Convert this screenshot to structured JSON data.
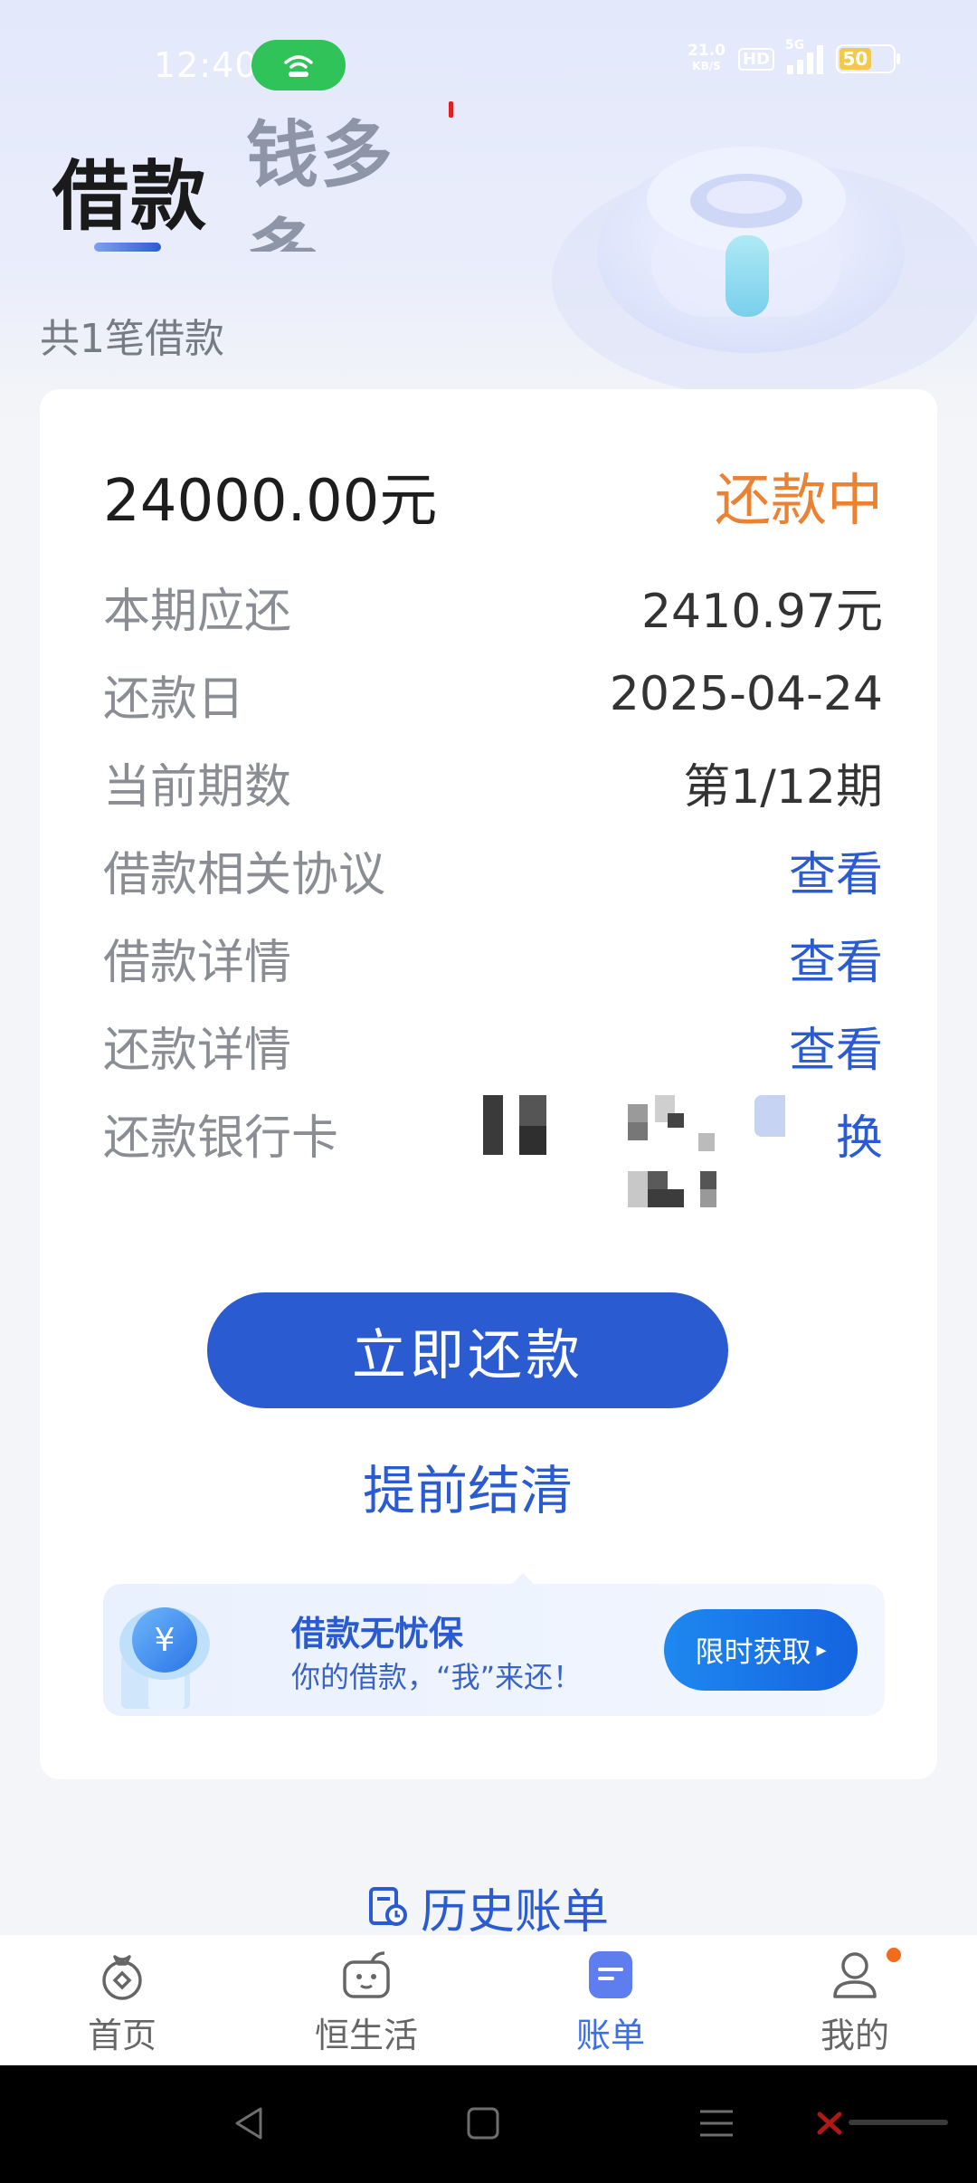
{
  "status_bar": {
    "time": "12:40",
    "net_speed_value": "21.0",
    "net_speed_unit": "KB/S",
    "hd_label": "HD",
    "network_type": "5G",
    "battery_level": "50"
  },
  "tabs": [
    {
      "label": "借款",
      "active": true
    },
    {
      "label": "钱多多",
      "active": false
    }
  ],
  "loan_count_text": "共1笔借款",
  "loan_card": {
    "amount": "24000.00元",
    "status": "还款中",
    "rows": [
      {
        "label": "本期应还",
        "value": "2410.97元"
      },
      {
        "label": "还款日",
        "value": "2025-04-24"
      },
      {
        "label": "当前期数",
        "value": "第1/12期"
      },
      {
        "label": "借款相关协议",
        "link": "查看"
      },
      {
        "label": "借款详情",
        "link": "查看"
      },
      {
        "label": "还款详情",
        "link": "查看"
      },
      {
        "label": "还款银行卡",
        "link": "换"
      }
    ],
    "repay_button": "立即还款",
    "settle_link": "提前结清",
    "promo": {
      "title": "借款无忧保",
      "subtitle": "你的借款，“我”来还！",
      "button": "限时获取",
      "button_arrow": "▸"
    }
  },
  "history_link": "历史账单",
  "bottom_nav": [
    {
      "label": "首页",
      "icon": "home-money-bag-icon",
      "active": false
    },
    {
      "label": "恒生活",
      "icon": "life-tv-icon",
      "active": false
    },
    {
      "label": "账单",
      "icon": "bill-icon",
      "active": true
    },
    {
      "label": "我的",
      "icon": "profile-icon",
      "active": false
    }
  ],
  "colors": {
    "primary": "#2b5bd1",
    "status_orange": "#e98233",
    "active_tab": "#3b6ee8",
    "hotspot_green": "#2fc35a",
    "badge_orange": "#f26b1d"
  }
}
